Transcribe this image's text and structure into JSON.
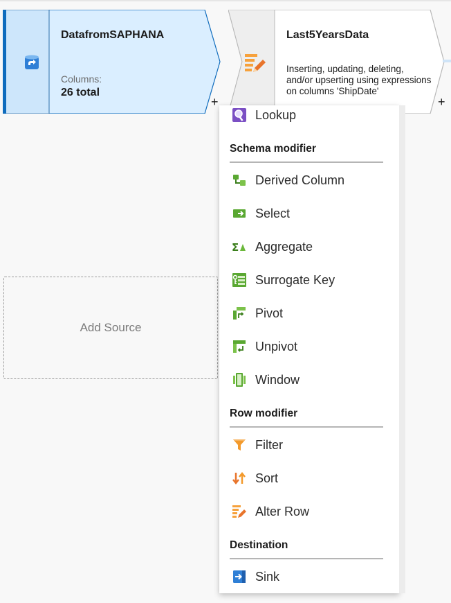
{
  "flow": {
    "source_node": {
      "title": "DatafromSAPHANA",
      "columns_label": "Columns:",
      "columns_value": "26 total",
      "icon": "database-source-icon"
    },
    "transform_node": {
      "title": "Last5YearsData",
      "description": "Inserting, updating, deleting, and/or upserting using expressions on columns 'ShipDate'",
      "icon": "alter-row-icon"
    },
    "add_transform_label": "+",
    "add_source_label": "Add Source"
  },
  "menu": {
    "lookup": "Lookup",
    "sections": [
      {
        "header": "Schema modifier",
        "items": [
          {
            "label": "Derived Column",
            "icon": "derived-column-icon"
          },
          {
            "label": "Select",
            "icon": "select-icon"
          },
          {
            "label": "Aggregate",
            "icon": "aggregate-icon"
          },
          {
            "label": "Surrogate Key",
            "icon": "surrogate-key-icon"
          },
          {
            "label": "Pivot",
            "icon": "pivot-icon"
          },
          {
            "label": "Unpivot",
            "icon": "unpivot-icon"
          },
          {
            "label": "Window",
            "icon": "window-icon"
          }
        ]
      },
      {
        "header": "Row modifier",
        "items": [
          {
            "label": "Filter",
            "icon": "filter-icon"
          },
          {
            "label": "Sort",
            "icon": "sort-icon"
          },
          {
            "label": "Alter Row",
            "icon": "alter-row-icon"
          }
        ]
      },
      {
        "header": "Destination",
        "items": [
          {
            "label": "Sink",
            "icon": "sink-icon"
          }
        ]
      }
    ]
  },
  "colors": {
    "node_selected_fill": "#daeeff",
    "node_selected_border": "#0f6cbd",
    "node_fill": "#ffffff",
    "node_icon_area": "#eeeeee",
    "accent": "#0f6cbd"
  }
}
